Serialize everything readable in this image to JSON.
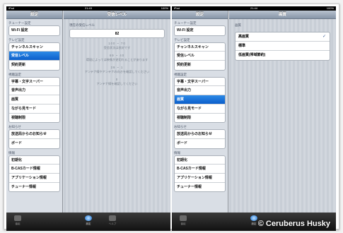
{
  "left": {
    "status": {
      "carrier": "iPad",
      "time": "21:43",
      "battery": "100%"
    },
    "sidebar": {
      "title": "設定",
      "sections": [
        {
          "header": "チューナー設定",
          "items": [
            "Wi-Fi 設定"
          ]
        },
        {
          "header": "テレビ設定",
          "items": [
            "チャンネルスキャン",
            "受信レベル",
            "契約更新"
          ]
        },
        {
          "header": "視聴設定",
          "items": [
            "字幕・文字スーパー",
            "音声出力",
            "画質",
            "ながら見モード",
            "視聴制限"
          ]
        },
        {
          "header": "お知らせ",
          "items": [
            "放送局からのお知らせ",
            "ボード"
          ]
        },
        {
          "header": "情報",
          "items": [
            "初期化",
            "B-CASカード情報",
            "アプリケーション情報",
            "チューナー情報"
          ]
        }
      ],
      "selected": "受信レベル"
    },
    "detail": {
      "title": "受信レベル",
      "level_label": "現在の受信レベル",
      "level_value": "82",
      "refs": [
        {
          "range": "100 ~ 70",
          "desc": "受信状況は良好です"
        },
        {
          "range": "69 ~ 40",
          "desc": "環境によっては映像が途切れることがあります"
        },
        {
          "range": "39 ~ 1",
          "desc": "アンテナ線やアンテナの向きを確認してください"
        },
        {
          "range": "0",
          "desc": "アンテナ線を確認してください"
        }
      ]
    },
    "tabs": [
      {
        "label": "番組"
      },
      {
        "label": "設定"
      },
      {
        "label": "ヘルプ"
      }
    ]
  },
  "right": {
    "status": {
      "carrier": "iPad",
      "time": "21:44",
      "battery": "100%"
    },
    "sidebar": {
      "title": "設定",
      "sections": [
        {
          "header": "チューナー設定",
          "items": [
            "Wi-Fi 設定"
          ]
        },
        {
          "header": "テレビ設定",
          "items": [
            "チャンネルスキャン",
            "受信レベル",
            "契約更新"
          ]
        },
        {
          "header": "視聴設定",
          "items": [
            "字幕・文字スーパー",
            "音声出力",
            "画質",
            "ながら見モード",
            "視聴制限"
          ]
        },
        {
          "header": "お知らせ",
          "items": [
            "放送局からのお知らせ",
            "ボード"
          ]
        },
        {
          "header": "情報",
          "items": [
            "初期化",
            "B-CASカード情報",
            "アプリケーション情報",
            "チューナー情報"
          ]
        }
      ],
      "selected": "画質"
    },
    "detail": {
      "title": "画質",
      "section": "画質",
      "options": [
        "高画質",
        "標準",
        "低画質(帯域節約)"
      ],
      "checked": "高画質",
      "check_mark": "✓"
    },
    "tabs": [
      {
        "label": "番組"
      },
      {
        "label": "設定"
      }
    ],
    "copyright": "© Ceruberus Husky"
  }
}
